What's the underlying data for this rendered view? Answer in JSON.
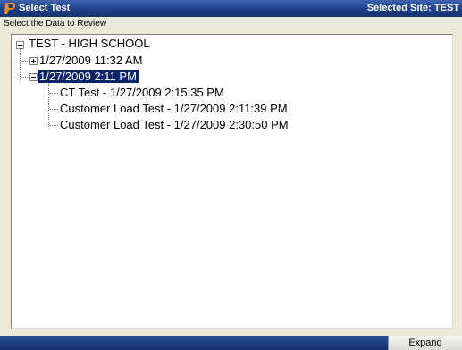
{
  "window": {
    "title": "Select Test",
    "site_label": "Selected Site: TEST",
    "subtitle": "Select the Data to Review"
  },
  "tree": {
    "root": {
      "label": "TEST - HIGH SCHOOL",
      "expanded": true,
      "children": [
        {
          "label": "1/27/2009 11:32 AM",
          "expanded": false
        },
        {
          "label": "1/27/2009 2:11 PM",
          "expanded": true,
          "selected": true,
          "children": [
            {
              "label": "CT Test - 1/27/2009 2:15:35 PM"
            },
            {
              "label": "Customer Load Test - 1/27/2009 2:11:39 PM"
            },
            {
              "label": "Customer Load Test - 1/27/2009 2:30:50 PM"
            }
          ]
        }
      ]
    }
  },
  "footer": {
    "expand_label": "Expand"
  },
  "colors": {
    "titlebar": "#1f3f86",
    "selection": "#0a246a",
    "window_bg": "#ece9d8"
  },
  "icons": {
    "app": "logo-icon",
    "collapse": "minus-box-icon",
    "expand": "plus-box-icon"
  }
}
